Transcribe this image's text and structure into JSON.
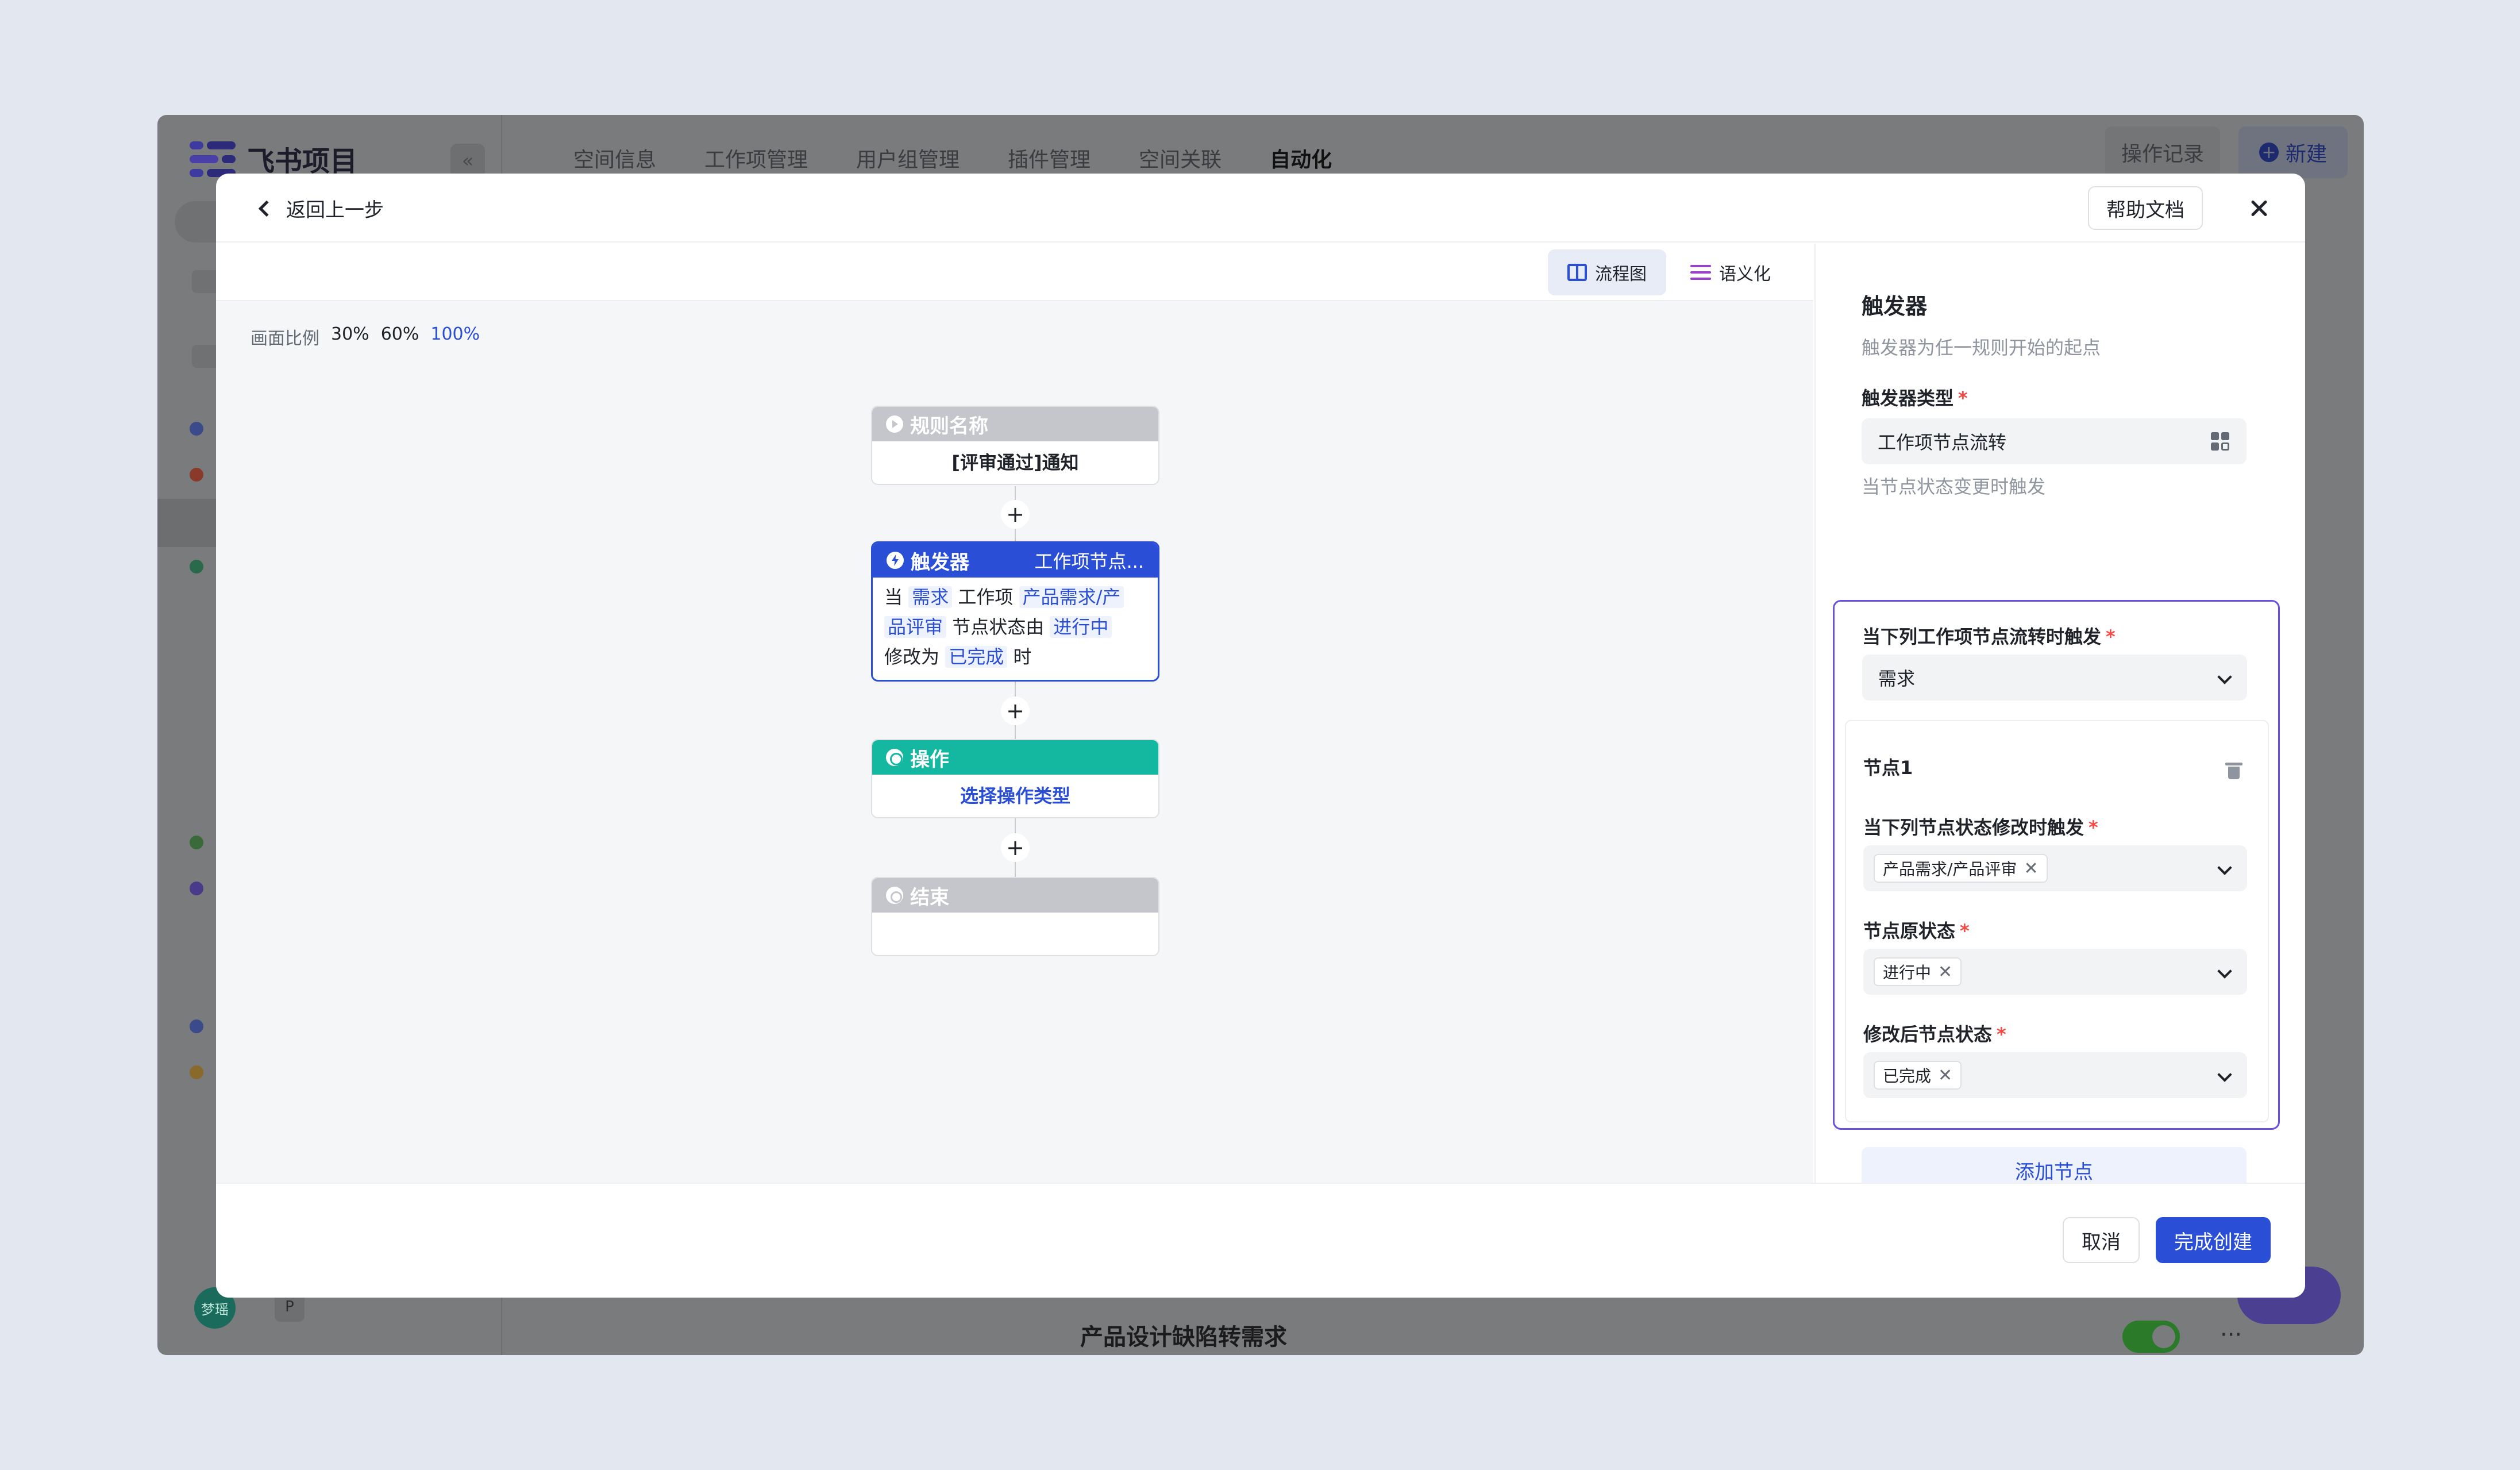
{
  "app": {
    "title": "飞书项目",
    "tabs": [
      "空间信息",
      "工作项管理",
      "用户组管理",
      "插件管理",
      "空间关联",
      "自动化"
    ],
    "op_log": "操作记录",
    "new_button": "新建",
    "bg_rule_name": "产品设计缺陷转需求",
    "user_avatar_text": "梦瑶",
    "user_badge": "P"
  },
  "modal": {
    "back_label": "返回上一步",
    "help_label": "帮助文档",
    "view_flow": "流程图",
    "view_semantic": "语义化",
    "zoom_label": "画面比例",
    "zoom_options": [
      "30%",
      "60%",
      "100%"
    ],
    "nodes": {
      "rule_title": "规则名称",
      "rule_value": "[评审通过]通知",
      "trigger_title": "触发器",
      "trigger_type_short": "工作项节点...",
      "trigger_text": {
        "w1": "当",
        "t1": "需求",
        "w2": "工作项",
        "t2": "产品需求/产",
        "t3": "品评审",
        "w3": "节点状态由",
        "t4": "进行中",
        "w4": "修改为",
        "t5": "已完成",
        "w5": "时"
      },
      "action_title": "操作",
      "action_value": "选择操作类型",
      "end_title": "结束"
    },
    "panel": {
      "title": "触发器",
      "subtitle": "触发器为任一规则开始的起点",
      "type_label": "触发器类型",
      "type_value": "工作项节点流转",
      "type_hint": "当节点状态变更时触发",
      "workitem_label": "当下列工作项节点流转时触发",
      "workitem_value": "需求",
      "node_title": "节点1",
      "node_trigger_label": "当下列节点状态修改时触发",
      "node_trigger_tag": "产品需求/产品评审",
      "from_label": "节点原状态",
      "from_tag": "进行中",
      "to_label": "修改后节点状态",
      "to_tag": "已完成",
      "add_node": "添加节点",
      "required_mark": "*"
    },
    "cancel": "取消",
    "confirm": "完成创建"
  },
  "colors": {
    "accent": "#2a4fd6",
    "action": "#14b8a0",
    "group_border": "#6a4fe0"
  }
}
